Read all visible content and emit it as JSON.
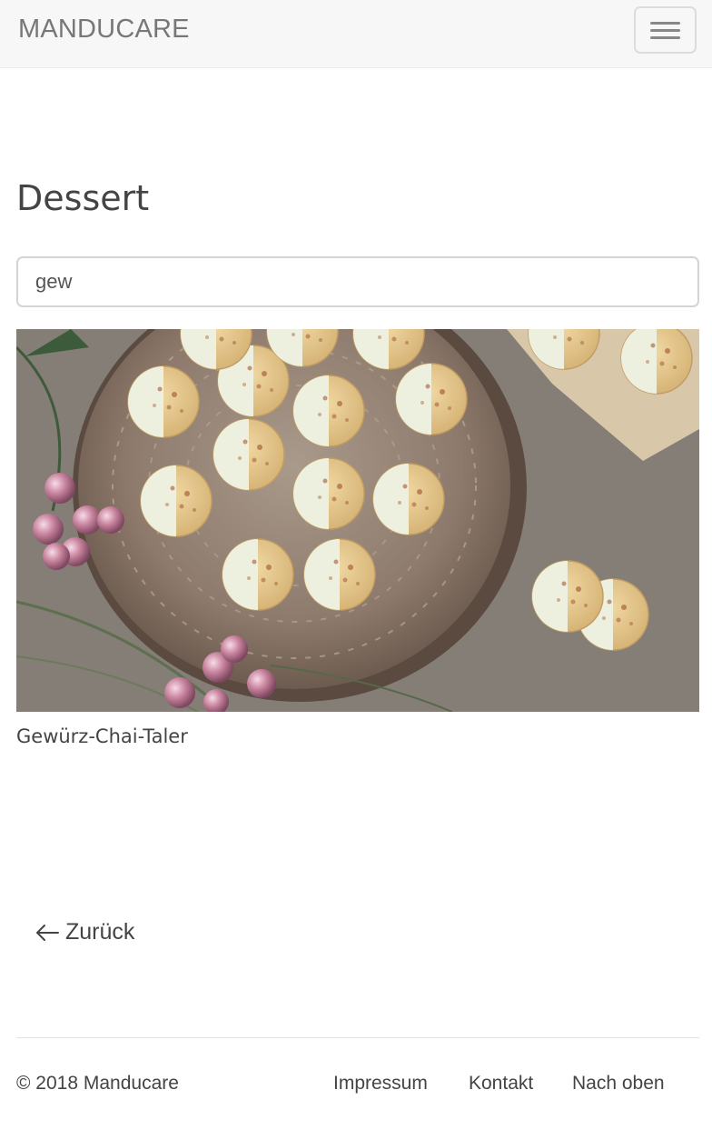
{
  "navbar": {
    "brand": "MANDUCARE",
    "menu_icon": "hamburger-menu-icon"
  },
  "page": {
    "title": "Dessert"
  },
  "search": {
    "value": "gew"
  },
  "results": [
    {
      "title": "Gewürz-Chai-Taler",
      "image_icon": "food-photo"
    }
  ],
  "back_link": {
    "label": "Zurück",
    "icon": "arrow-left-icon"
  },
  "footer": {
    "copyright": "© 2018 Manducare",
    "links": [
      "Impressum",
      "Kontakt",
      "Nach oben"
    ]
  }
}
